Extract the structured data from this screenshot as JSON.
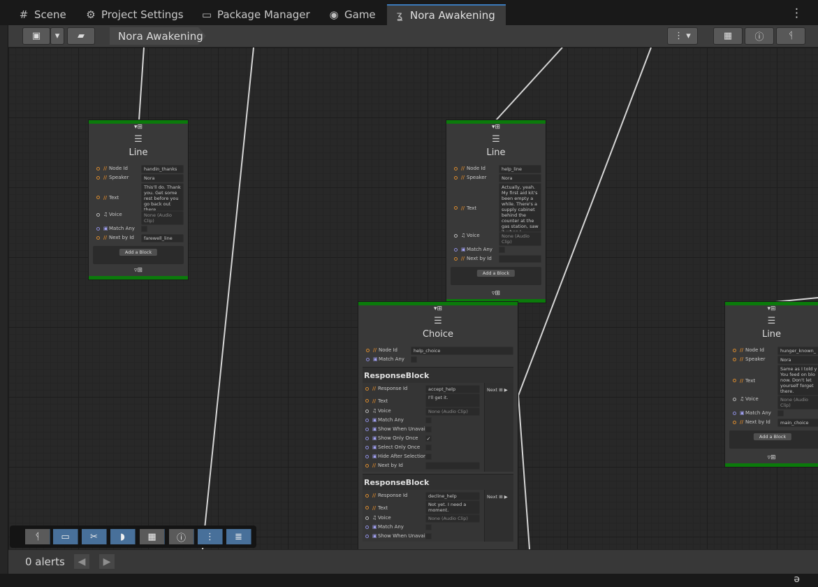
{
  "tabs": [
    {
      "label": "Scene",
      "icon": "#"
    },
    {
      "label": "Project Settings",
      "icon": "⚙"
    },
    {
      "label": "Package Manager",
      "icon": "▭"
    },
    {
      "label": "Game",
      "icon": "◉"
    },
    {
      "label": "Nora Awakening",
      "icon": "ʓ"
    }
  ],
  "tab_menu_icon": "⋮",
  "toolbar": {
    "breadcrumb": "Nora Awakening",
    "save_icon": "▣",
    "dropdown_icon": "▾",
    "folder_icon": "▰",
    "more_icon": "⋮ ▾",
    "blackboard_icon": "▦",
    "inspector_icon": "ⓘ",
    "minimap_icon": "ᛩ"
  },
  "nodes": {
    "handin": {
      "title": "Line",
      "node_icon": "☰",
      "port_in": "▾⊞",
      "port_out": "▿⊞",
      "fields": {
        "node_id_label": "Node Id",
        "node_id": "handin_thanks",
        "speaker_label": "Speaker",
        "speaker": "Nora",
        "text_label": "Text",
        "text": "This'll do. Thank you. Get some rest before you go back out there.",
        "voice_label": "Voice",
        "voice": "None (Audio Clip)",
        "match_any_label": "Match Any",
        "next_by_id_label": "Next by Id",
        "next_by_id": "farewell_line"
      },
      "add_block": "Add a Block"
    },
    "help": {
      "title": "Line",
      "node_icon": "☰",
      "port_in": "▾⊞",
      "port_out": "▿⊞",
      "fields": {
        "node_id_label": "Node Id",
        "node_id": "help_line",
        "speaker_label": "Speaker",
        "speaker": "Nora",
        "text_label": "Text",
        "text": "Actually, yeah. My first aid kit's been empty a while. There's a supply cabinet behind the counter at the gas station, saw it when I scouted",
        "voice_label": "Voice",
        "voice": "None (Audio Clip)",
        "match_any_label": "Match Any",
        "next_by_id_label": "Next by Id",
        "next_by_id": ""
      },
      "add_block": "Add a Block"
    },
    "choice": {
      "title": "Choice",
      "node_icon": "☰",
      "port_in": "▾⊞",
      "fields": {
        "node_id_label": "Node Id",
        "node_id": "help_choice",
        "match_any_label": "Match Any"
      },
      "blocks": [
        {
          "heading": "ResponseBlock",
          "response_id_label": "Response Id",
          "response_id": "accept_help",
          "text_label": "Text",
          "text": "I'll get it.",
          "voice_label": "Voice",
          "voice": "None (Audio Clip)",
          "match_any_label": "Match Any",
          "show_when_unavailable_label": "Show When Unavailable",
          "show_only_once_label": "Show Only Once",
          "show_only_once_check": "✓",
          "select_only_once_label": "Select Only Once",
          "hide_after_selection_label": "Hide After Selection",
          "next_by_id_label": "Next by Id",
          "next_port": "Next ⊞ ▶"
        },
        {
          "heading": "ResponseBlock",
          "response_id_label": "Response Id",
          "response_id": "decline_help",
          "text_label": "Text",
          "text": "Not yet. I need a moment.",
          "voice_label": "Voice",
          "voice": "None (Audio Clip)",
          "match_any_label": "Match Any",
          "show_when_unavailable_label": "Show When Unavailable",
          "next_port": "Next ⊞ ▶"
        }
      ]
    },
    "hunger": {
      "title": "Line",
      "node_icon": "☰",
      "port_in": "▾⊞",
      "port_out": "▿⊞",
      "fields": {
        "node_id_label": "Node Id",
        "node_id": "hunger_known_",
        "speaker_label": "Speaker",
        "speaker": "Nora",
        "text_label": "Text",
        "text": "Same as I told y You feed on blo now. Don't let yourself forget there.",
        "voice_label": "Voice",
        "voice": "None (Audio Clip)",
        "match_any_label": "Match Any",
        "next_by_id_label": "Next by Id",
        "next_by_id": "main_choice"
      },
      "add_block": "Add a Block"
    }
  },
  "float_toolbar_icons": [
    "ᛩ",
    "▭",
    "✂",
    "◗",
    "▦",
    "ⓘ",
    "⋮",
    "≣"
  ],
  "status": {
    "alerts": "0 alerts",
    "prev": "◀",
    "next": "▶"
  },
  "bottom_icon": "ə"
}
